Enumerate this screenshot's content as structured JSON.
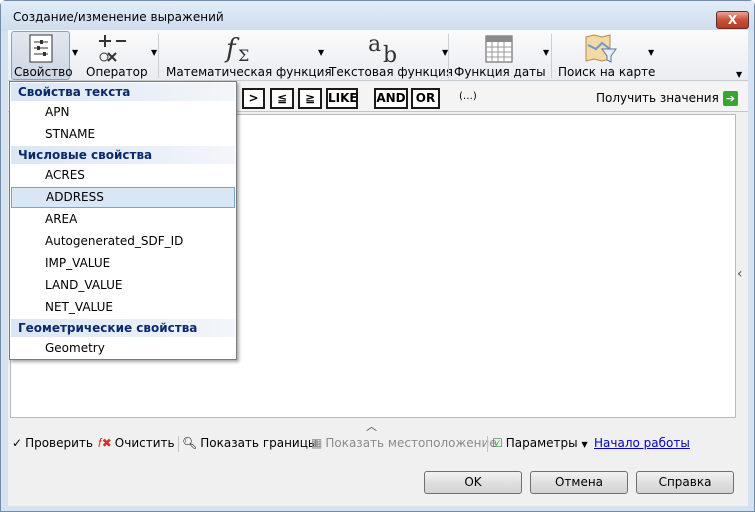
{
  "window": {
    "title": "Создание/изменение выражений",
    "close_label": "X"
  },
  "ribbon": {
    "property": "Свойство",
    "operator": "Оператор",
    "math": "Математическая функция",
    "text": "Текстовая функция",
    "date": "Функция даты",
    "map": "Поиск на карте"
  },
  "operators": [
    ">",
    "≦",
    "≧",
    "LIKE",
    "AND",
    "OR"
  ],
  "operator_paren": "(…)",
  "get_values": "Получить значения",
  "dropdown": {
    "groups": [
      {
        "header": "Свойства текста",
        "items": [
          "APN",
          "STNAME"
        ]
      },
      {
        "header": "Числовые свойства",
        "items": [
          "ACRES",
          "ADDRESS",
          "AREA",
          "Autogenerated_SDF_ID",
          "IMP_VALUE",
          "LAND_VALUE",
          "NET_VALUE"
        ]
      },
      {
        "header": "Геометрические свойства",
        "items": [
          "Geometry"
        ]
      }
    ],
    "selected": "ADDRESS"
  },
  "bottom": {
    "check": "Проверить",
    "clear": "Очистить",
    "show_extents": "Показать границы",
    "show_location": "Показать местоположение",
    "parameters": "Параметры",
    "getting_started": "Начало работы"
  },
  "buttons": {
    "ok": "OK",
    "cancel": "Отмена",
    "help": "Справка"
  },
  "colors": {
    "accent_header": "#0b2a6b",
    "selection": "#d8e6f6",
    "link": "#0000cc",
    "green_arrow": "#3aa431"
  }
}
